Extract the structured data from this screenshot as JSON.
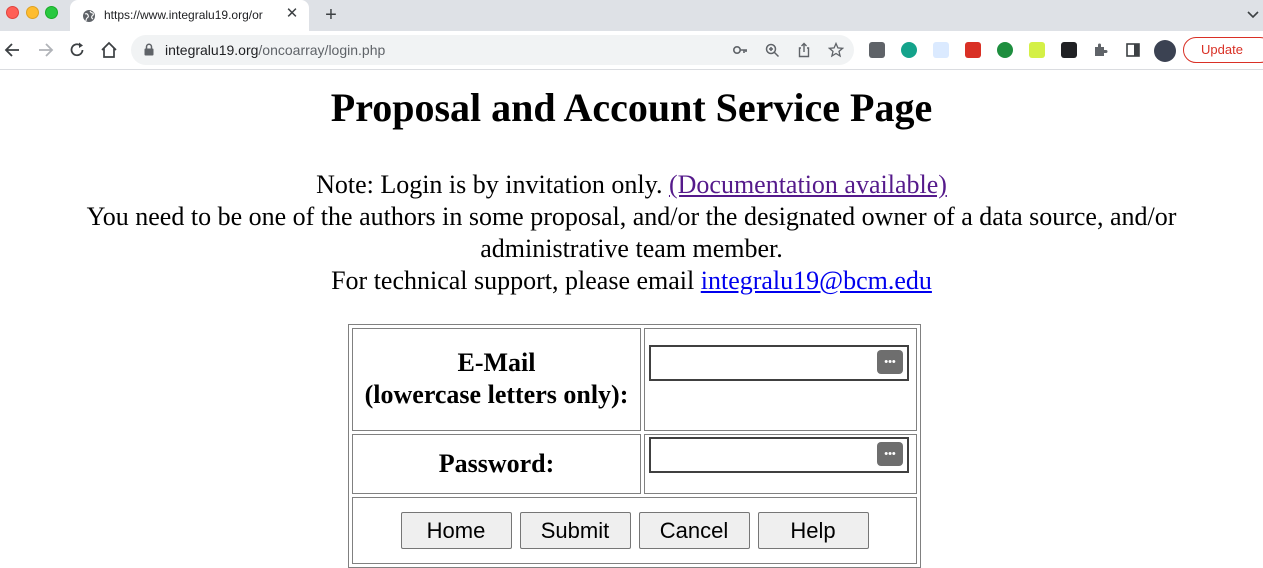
{
  "browser": {
    "tab_title": "https://www.integralu19.org/or",
    "tab_close": "✕",
    "new_tab": "+",
    "url_domain": "integralu19.org",
    "url_path": "/oncoarray/login.php",
    "update_label": "Update",
    "icons": [
      "back-icon",
      "forward-icon",
      "reload-icon",
      "home-icon",
      "key-icon",
      "zoom-icon",
      "share-icon",
      "star-icon",
      "extensions-icon",
      "sidepanel-icon",
      "profile-avatar"
    ],
    "colors": {
      "update": "#d93025",
      "tabstrip": "#dee1e6"
    }
  },
  "page": {
    "title": "Proposal and Account Service Page",
    "note_prefix": "Note: Login is by invitation only.",
    "doc_link": "(Documentation available)",
    "requirement": "You need to be one of the authors in some proposal, and/or the designated owner of a data source, and/or administrative team member.",
    "support_prefix": "For technical support, please email",
    "support_email": "integralu19@bcm.edu"
  },
  "form": {
    "email_label_line1": "E-Mail",
    "email_label_line2": "(lowercase letters only):",
    "email_value": "",
    "password_label": "Password:",
    "password_value": "",
    "pw_manager_icon": "•••",
    "buttons": {
      "home": "Home",
      "submit": "Submit",
      "cancel": "Cancel",
      "help": "Help"
    }
  }
}
